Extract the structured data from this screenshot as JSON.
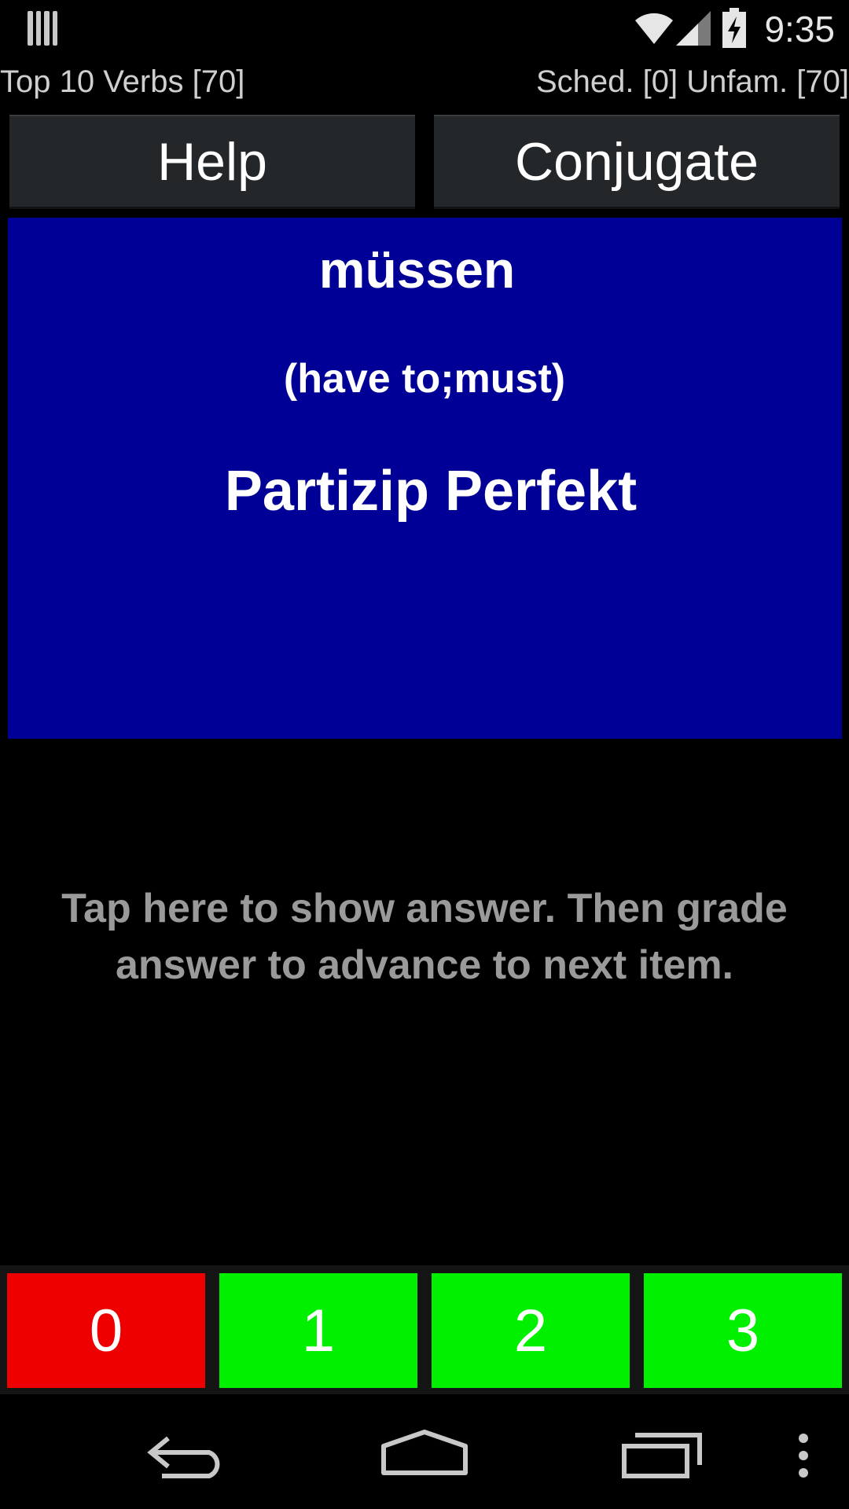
{
  "status_bar": {
    "time": "9:35",
    "icons": [
      "notification-icon",
      "wifi-icon",
      "signal-icon",
      "battery-charging-icon"
    ]
  },
  "info": {
    "deck": "Top 10 Verbs [70]",
    "stats": "Sched. [0] Unfam. [70]"
  },
  "toolbar": {
    "help_label": "Help",
    "conjugate_label": "Conjugate"
  },
  "card": {
    "word": "müssen",
    "translation": "(have to;must)",
    "form": "Partizip Perfekt",
    "background": "#000096"
  },
  "hint": "Tap here to show answer. Then grade answer to advance to next item.",
  "grades": [
    {
      "label": "0",
      "color": "#ee0000"
    },
    {
      "label": "1",
      "color": "#00f000"
    },
    {
      "label": "2",
      "color": "#00f000"
    },
    {
      "label": "3",
      "color": "#00f000"
    }
  ],
  "nav_bar": {
    "icons": [
      "back-icon",
      "home-icon",
      "recents-icon",
      "menu-icon"
    ]
  }
}
